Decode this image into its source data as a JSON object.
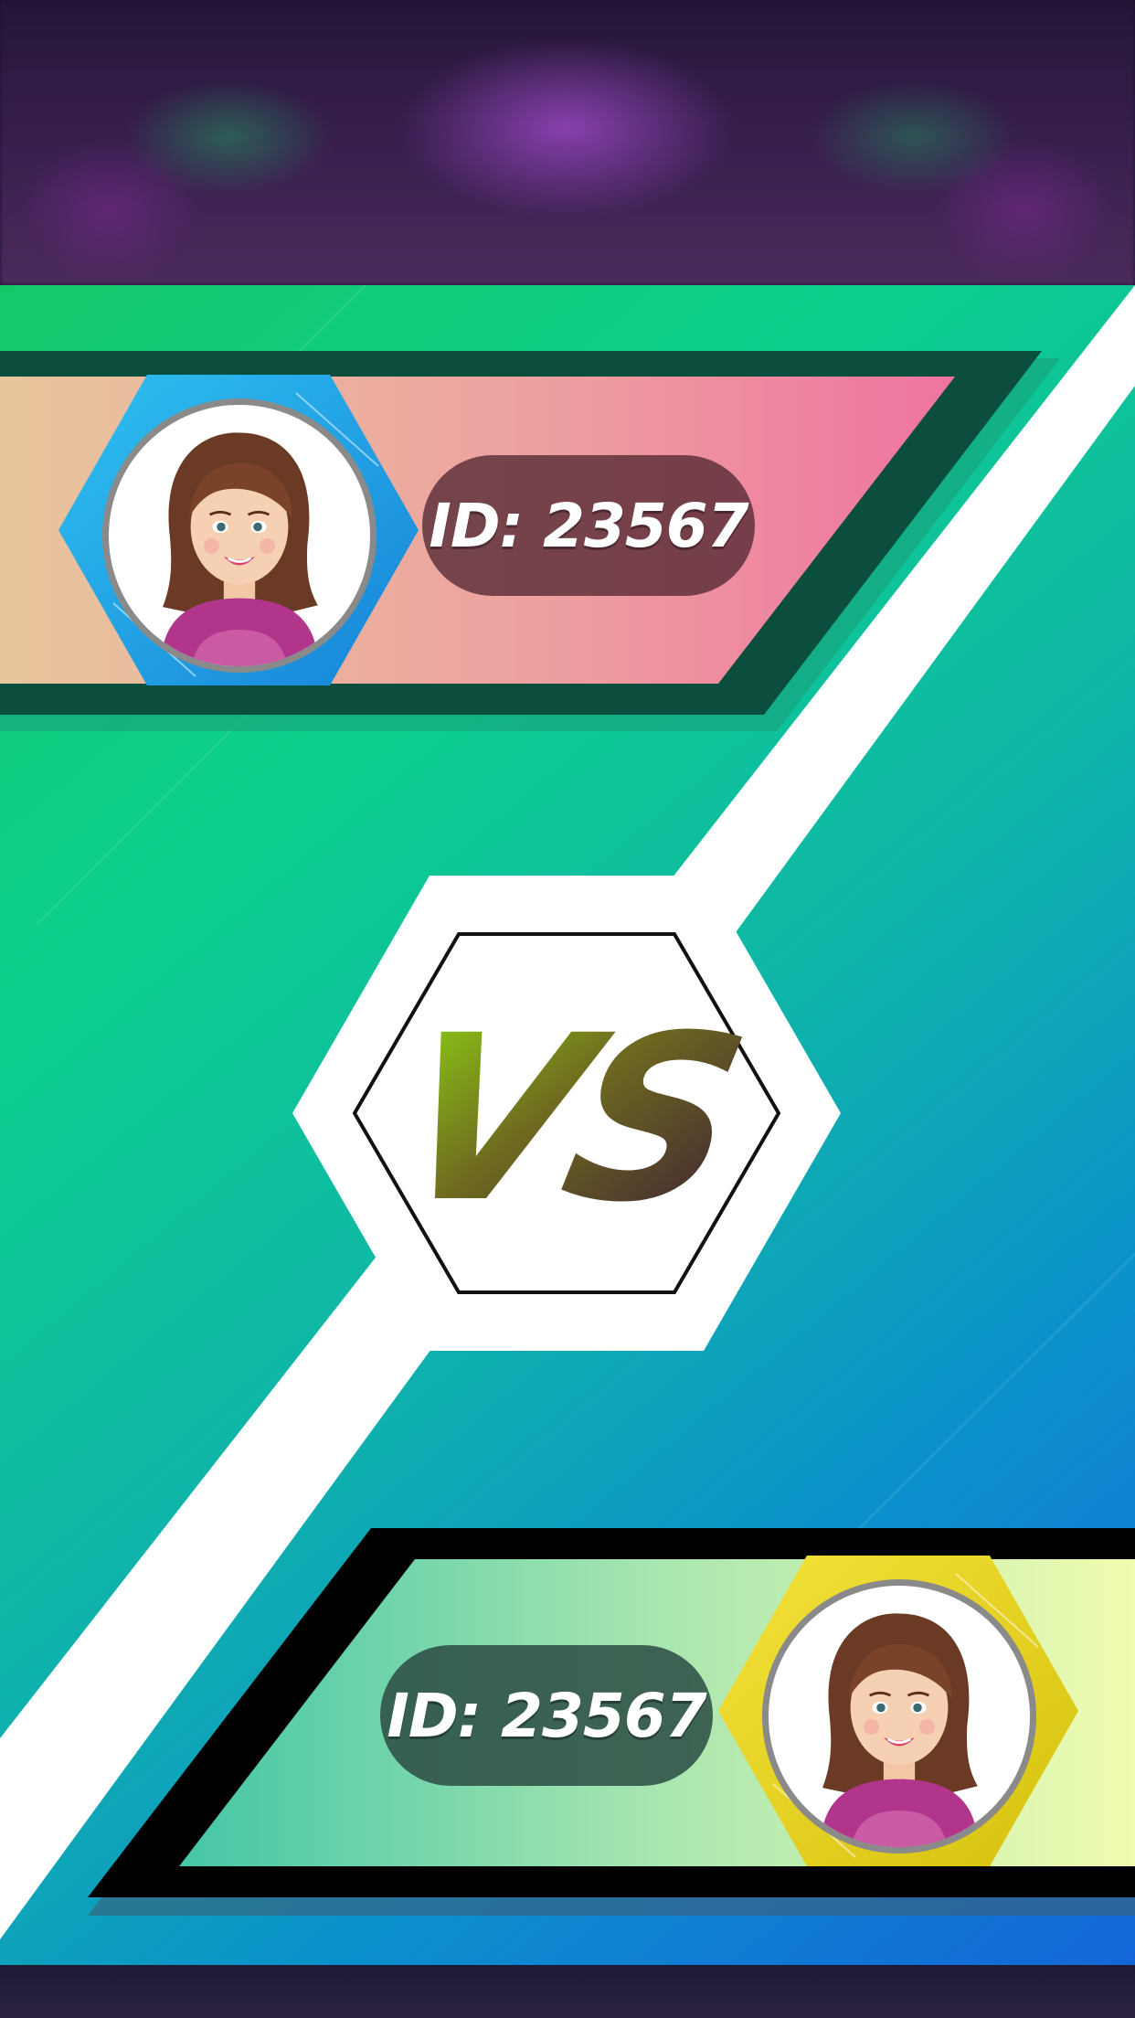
{
  "screen": "versus-match",
  "top_player": {
    "id_label": "ID: 23567",
    "avatar_icon": "woman-avatar-icon",
    "frame_color": "#2aa6e8",
    "banner_gradient": [
      "#e9c49e",
      "#ee7aa0"
    ]
  },
  "center": {
    "vs_label": "VS",
    "vs_gradient": [
      "#8ed414",
      "#3d1f35"
    ]
  },
  "bottom_player": {
    "id_label": "ID: 23567",
    "avatar_icon": "woman-avatar-icon",
    "frame_color": "#e6d31a",
    "banner_gradient": [
      "#48c8a5",
      "#eefcb0"
    ]
  },
  "colors": {
    "arena_green": "#14c86a",
    "arena_blue": "#1466d8",
    "stripe": "#ffffff",
    "top_banner_border": "#0c4e3e",
    "bottom_banner_border": "#000000"
  }
}
